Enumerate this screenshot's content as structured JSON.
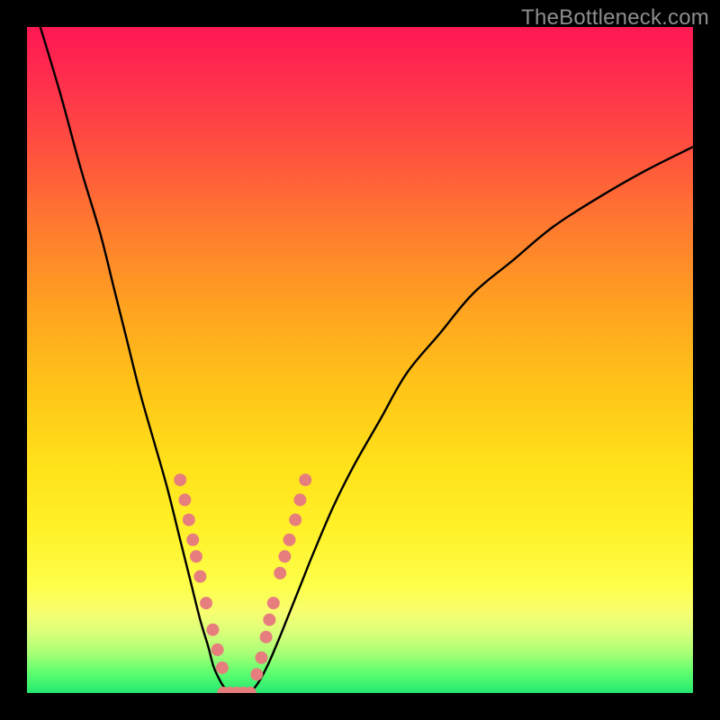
{
  "watermark": "TheBottleneck.com",
  "chart_data": {
    "type": "line",
    "title": "",
    "xlabel": "",
    "ylabel": "",
    "xlim": [
      0,
      100
    ],
    "ylim": [
      0,
      100
    ],
    "grid": false,
    "legend": false,
    "series": [
      {
        "name": "left-curve",
        "color": "#000000",
        "x": [
          2,
          5,
          8,
          11,
          13,
          15,
          17,
          19,
          21,
          23,
          24.5,
          26,
          27.2,
          28,
          28.8,
          29.5,
          30.2,
          31
        ],
        "y": [
          100,
          90,
          79,
          69,
          61,
          53,
          45,
          38,
          31,
          23,
          17,
          11,
          7,
          4,
          2.2,
          1.0,
          0.3,
          0
        ]
      },
      {
        "name": "right-curve",
        "color": "#000000",
        "x": [
          33,
          34,
          35,
          36.2,
          37.5,
          39,
          41,
          43,
          46,
          49,
          53,
          57,
          62,
          67,
          73,
          79,
          86,
          93,
          100
        ],
        "y": [
          0,
          0.6,
          2.0,
          4.3,
          7.3,
          11,
          16,
          21,
          28,
          34,
          41,
          48,
          54,
          60,
          65,
          70,
          74.5,
          78.5,
          82
        ]
      }
    ],
    "markers": [
      {
        "name": "cluster-dot",
        "series_hint": "left-curve",
        "x": 23.0,
        "y": 32.0
      },
      {
        "name": "cluster-dot",
        "series_hint": "left-curve",
        "x": 23.7,
        "y": 29.0
      },
      {
        "name": "cluster-dot",
        "series_hint": "left-curve",
        "x": 24.3,
        "y": 26.0
      },
      {
        "name": "cluster-dot",
        "series_hint": "left-curve",
        "x": 24.9,
        "y": 23.0
      },
      {
        "name": "cluster-dot",
        "series_hint": "left-curve",
        "x": 25.4,
        "y": 20.5
      },
      {
        "name": "cluster-dot",
        "series_hint": "left-curve",
        "x": 26.0,
        "y": 17.5
      },
      {
        "name": "cluster-dot",
        "series_hint": "left-curve",
        "x": 26.9,
        "y": 13.5
      },
      {
        "name": "cluster-dot",
        "series_hint": "left-curve",
        "x": 27.9,
        "y": 9.5
      },
      {
        "name": "cluster-dot",
        "series_hint": "left-curve",
        "x": 28.6,
        "y": 6.5
      },
      {
        "name": "cluster-dot",
        "series_hint": "left-curve",
        "x": 29.3,
        "y": 3.8
      },
      {
        "name": "cluster-dot",
        "series_hint": "floor",
        "x": 29.5,
        "y": 0.0
      },
      {
        "name": "cluster-dot",
        "series_hint": "floor",
        "x": 30.5,
        "y": 0.0
      },
      {
        "name": "cluster-dot",
        "series_hint": "floor",
        "x": 31.5,
        "y": 0.0
      },
      {
        "name": "cluster-dot",
        "series_hint": "floor",
        "x": 32.5,
        "y": 0.0
      },
      {
        "name": "cluster-dot",
        "series_hint": "floor",
        "x": 33.5,
        "y": 0.0
      },
      {
        "name": "cluster-dot",
        "series_hint": "right-curve",
        "x": 34.5,
        "y": 2.8
      },
      {
        "name": "cluster-dot",
        "series_hint": "right-curve",
        "x": 35.2,
        "y": 5.3
      },
      {
        "name": "cluster-dot",
        "series_hint": "right-curve",
        "x": 35.9,
        "y": 8.4
      },
      {
        "name": "cluster-dot",
        "series_hint": "right-curve",
        "x": 36.4,
        "y": 11.0
      },
      {
        "name": "cluster-dot",
        "series_hint": "right-curve",
        "x": 37.0,
        "y": 13.5
      },
      {
        "name": "cluster-dot",
        "series_hint": "right-curve",
        "x": 38.0,
        "y": 18.0
      },
      {
        "name": "cluster-dot",
        "series_hint": "right-curve",
        "x": 38.7,
        "y": 20.5
      },
      {
        "name": "cluster-dot",
        "series_hint": "right-curve",
        "x": 39.4,
        "y": 23.0
      },
      {
        "name": "cluster-dot",
        "series_hint": "right-curve",
        "x": 40.3,
        "y": 26.0
      },
      {
        "name": "cluster-dot",
        "series_hint": "right-curve",
        "x": 41.0,
        "y": 29.0
      },
      {
        "name": "cluster-dot",
        "series_hint": "right-curve",
        "x": 41.8,
        "y": 32.0
      }
    ],
    "marker_style": {
      "color": "#e77e7e",
      "radius_px": 7
    },
    "background_gradient": {
      "direction": "top-to-bottom",
      "stops": [
        {
          "pct": 0,
          "color": "#ff1854"
        },
        {
          "pct": 18,
          "color": "#ff4f3f"
        },
        {
          "pct": 42,
          "color": "#ffa220"
        },
        {
          "pct": 66,
          "color": "#ffe21a"
        },
        {
          "pct": 88,
          "color": "#f7ff71"
        },
        {
          "pct": 100,
          "color": "#24e86f"
        }
      ]
    }
  }
}
